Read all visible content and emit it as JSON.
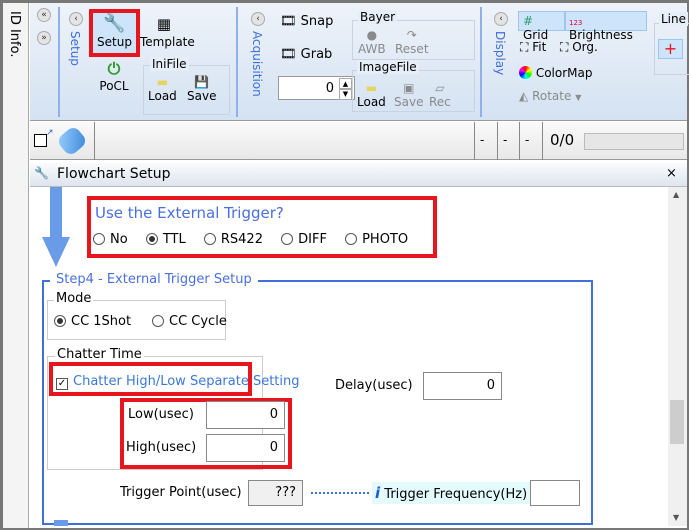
{
  "side_panel": {
    "label": "ID Info."
  },
  "ribbon": {
    "setup_group": {
      "label": "Setup",
      "setup": "Setup",
      "template": "Template",
      "pocl": "PoCL",
      "inifile": {
        "label": "IniFile",
        "load": "Load",
        "save": "Save"
      }
    },
    "acquisition_group": {
      "label": "Acquisition",
      "snap": "Snap",
      "grab": "Grab",
      "counter_value": "0"
    },
    "bayer": {
      "label": "Bayer",
      "awb": "AWB",
      "reset": "Reset"
    },
    "imagefile": {
      "label": "ImageFile",
      "load": "Load",
      "save": "Save",
      "rec": "Rec"
    },
    "display_group": {
      "label": "Display",
      "grid": "Grid",
      "brightness": "Brightness",
      "fit": "Fit",
      "org": "Org.",
      "colormap": "ColorMap",
      "rotate": "Rotate"
    },
    "line_group": {
      "label": "Line"
    }
  },
  "toolbar": {
    "field1": "-",
    "field2": "-",
    "field3": "-",
    "counter": "0/0",
    "progress": 0
  },
  "panel": {
    "title": "Flowchart Setup",
    "trigger_question": "Use the External Trigger?",
    "trigger_options": [
      {
        "label": "No",
        "selected": false
      },
      {
        "label": "TTL",
        "selected": true
      },
      {
        "label": "RS422",
        "selected": false
      },
      {
        "label": "DIFF",
        "selected": false
      },
      {
        "label": "PHOTO",
        "selected": false
      }
    ],
    "step_title": "Step4 - External Trigger Setup",
    "mode": {
      "label": "Mode",
      "options": [
        {
          "label": "CC 1Shot",
          "selected": true
        },
        {
          "label": "CC Cycle",
          "selected": false
        }
      ]
    },
    "chatter": {
      "label": "Chatter Time",
      "separate_label": "Chatter High/Low Separate Setting",
      "separate_checked": true,
      "low_label": "Low(usec)",
      "low_value": "0",
      "high_label": "High(usec)",
      "high_value": "0"
    },
    "delay": {
      "label": "Delay(usec)",
      "value": "0"
    },
    "trigger_point": {
      "label": "Trigger Point(usec)",
      "value": "???"
    },
    "trigger_frequency": {
      "label": "Trigger Frequency(Hz)",
      "value": ""
    }
  },
  "colors": {
    "highlight": "#e8151f",
    "accent": "#3c78d8",
    "section_border": "#3f6fd8"
  }
}
